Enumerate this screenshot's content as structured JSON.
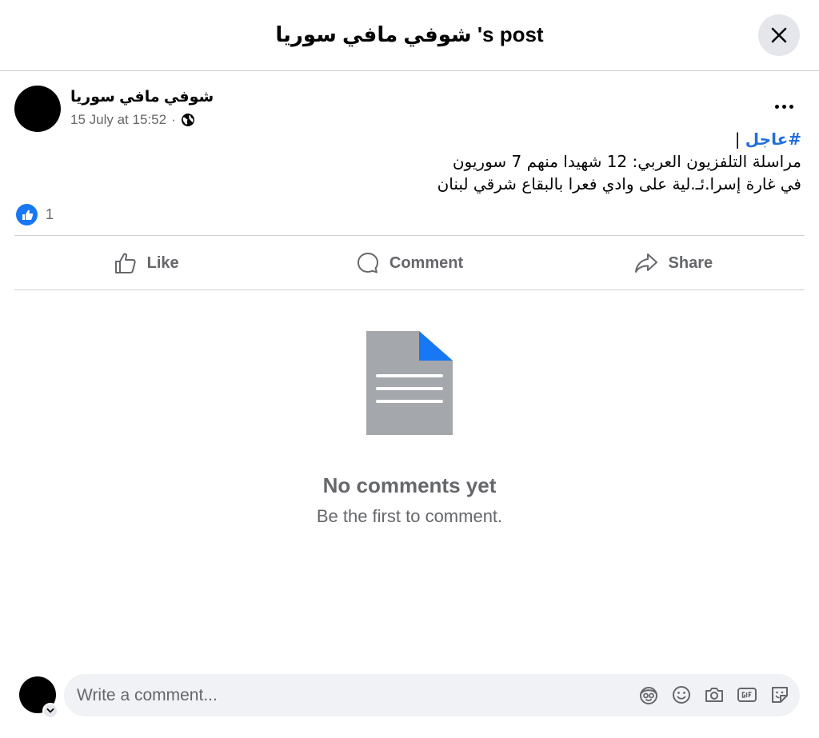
{
  "header": {
    "title": "شوفي مافي سوريا 's post"
  },
  "post": {
    "author": "شوفي مافي سوريا",
    "timestamp": "15 July at 15:52",
    "separator": "·",
    "hashtag": "#عاجل",
    "hashtag_suffix": " |",
    "line1": "مراسلة التلفزيون العربي: 12 شهيدا منهم 7 سوريون",
    "line2": "في غارة إسرا.ئـ.لية على وادي فعرا بالبقاع شرقي لبنان",
    "reaction_count": "1"
  },
  "actions": {
    "like": "Like",
    "comment": "Comment",
    "share": "Share"
  },
  "comments": {
    "empty_title": "No comments yet",
    "empty_subtitle": "Be the first to comment."
  },
  "composer": {
    "placeholder": "Write a comment..."
  },
  "colors": {
    "accent": "#1877f2",
    "hashtag": "#216fdb",
    "secondary_text": "#65676b",
    "doc_gray": "#a4a7ab",
    "doc_corner": "#1877f2"
  }
}
